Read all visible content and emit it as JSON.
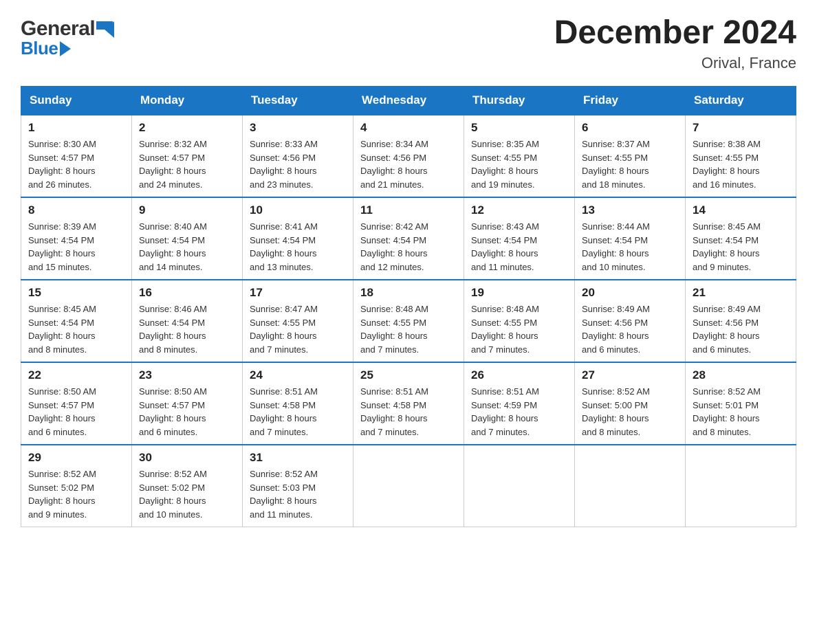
{
  "header": {
    "logo_general": "General",
    "logo_blue": "Blue",
    "month_title": "December 2024",
    "location": "Orival, France"
  },
  "days_of_week": [
    "Sunday",
    "Monday",
    "Tuesday",
    "Wednesday",
    "Thursday",
    "Friday",
    "Saturday"
  ],
  "weeks": [
    [
      {
        "day": "1",
        "sunrise": "8:30 AM",
        "sunset": "4:57 PM",
        "daylight": "8 hours and 26 minutes."
      },
      {
        "day": "2",
        "sunrise": "8:32 AM",
        "sunset": "4:57 PM",
        "daylight": "8 hours and 24 minutes."
      },
      {
        "day": "3",
        "sunrise": "8:33 AM",
        "sunset": "4:56 PM",
        "daylight": "8 hours and 23 minutes."
      },
      {
        "day": "4",
        "sunrise": "8:34 AM",
        "sunset": "4:56 PM",
        "daylight": "8 hours and 21 minutes."
      },
      {
        "day": "5",
        "sunrise": "8:35 AM",
        "sunset": "4:55 PM",
        "daylight": "8 hours and 19 minutes."
      },
      {
        "day": "6",
        "sunrise": "8:37 AM",
        "sunset": "4:55 PM",
        "daylight": "8 hours and 18 minutes."
      },
      {
        "day": "7",
        "sunrise": "8:38 AM",
        "sunset": "4:55 PM",
        "daylight": "8 hours and 16 minutes."
      }
    ],
    [
      {
        "day": "8",
        "sunrise": "8:39 AM",
        "sunset": "4:54 PM",
        "daylight": "8 hours and 15 minutes."
      },
      {
        "day": "9",
        "sunrise": "8:40 AM",
        "sunset": "4:54 PM",
        "daylight": "8 hours and 14 minutes."
      },
      {
        "day": "10",
        "sunrise": "8:41 AM",
        "sunset": "4:54 PM",
        "daylight": "8 hours and 13 minutes."
      },
      {
        "day": "11",
        "sunrise": "8:42 AM",
        "sunset": "4:54 PM",
        "daylight": "8 hours and 12 minutes."
      },
      {
        "day": "12",
        "sunrise": "8:43 AM",
        "sunset": "4:54 PM",
        "daylight": "8 hours and 11 minutes."
      },
      {
        "day": "13",
        "sunrise": "8:44 AM",
        "sunset": "4:54 PM",
        "daylight": "8 hours and 10 minutes."
      },
      {
        "day": "14",
        "sunrise": "8:45 AM",
        "sunset": "4:54 PM",
        "daylight": "8 hours and 9 minutes."
      }
    ],
    [
      {
        "day": "15",
        "sunrise": "8:45 AM",
        "sunset": "4:54 PM",
        "daylight": "8 hours and 8 minutes."
      },
      {
        "day": "16",
        "sunrise": "8:46 AM",
        "sunset": "4:54 PM",
        "daylight": "8 hours and 8 minutes."
      },
      {
        "day": "17",
        "sunrise": "8:47 AM",
        "sunset": "4:55 PM",
        "daylight": "8 hours and 7 minutes."
      },
      {
        "day": "18",
        "sunrise": "8:48 AM",
        "sunset": "4:55 PM",
        "daylight": "8 hours and 7 minutes."
      },
      {
        "day": "19",
        "sunrise": "8:48 AM",
        "sunset": "4:55 PM",
        "daylight": "8 hours and 7 minutes."
      },
      {
        "day": "20",
        "sunrise": "8:49 AM",
        "sunset": "4:56 PM",
        "daylight": "8 hours and 6 minutes."
      },
      {
        "day": "21",
        "sunrise": "8:49 AM",
        "sunset": "4:56 PM",
        "daylight": "8 hours and 6 minutes."
      }
    ],
    [
      {
        "day": "22",
        "sunrise": "8:50 AM",
        "sunset": "4:57 PM",
        "daylight": "8 hours and 6 minutes."
      },
      {
        "day": "23",
        "sunrise": "8:50 AM",
        "sunset": "4:57 PM",
        "daylight": "8 hours and 6 minutes."
      },
      {
        "day": "24",
        "sunrise": "8:51 AM",
        "sunset": "4:58 PM",
        "daylight": "8 hours and 7 minutes."
      },
      {
        "day": "25",
        "sunrise": "8:51 AM",
        "sunset": "4:58 PM",
        "daylight": "8 hours and 7 minutes."
      },
      {
        "day": "26",
        "sunrise": "8:51 AM",
        "sunset": "4:59 PM",
        "daylight": "8 hours and 7 minutes."
      },
      {
        "day": "27",
        "sunrise": "8:52 AM",
        "sunset": "5:00 PM",
        "daylight": "8 hours and 8 minutes."
      },
      {
        "day": "28",
        "sunrise": "8:52 AM",
        "sunset": "5:01 PM",
        "daylight": "8 hours and 8 minutes."
      }
    ],
    [
      {
        "day": "29",
        "sunrise": "8:52 AM",
        "sunset": "5:02 PM",
        "daylight": "8 hours and 9 minutes."
      },
      {
        "day": "30",
        "sunrise": "8:52 AM",
        "sunset": "5:02 PM",
        "daylight": "8 hours and 10 minutes."
      },
      {
        "day": "31",
        "sunrise": "8:52 AM",
        "sunset": "5:03 PM",
        "daylight": "8 hours and 11 minutes."
      },
      null,
      null,
      null,
      null
    ]
  ],
  "labels": {
    "sunrise": "Sunrise:",
    "sunset": "Sunset:",
    "daylight": "Daylight:"
  }
}
